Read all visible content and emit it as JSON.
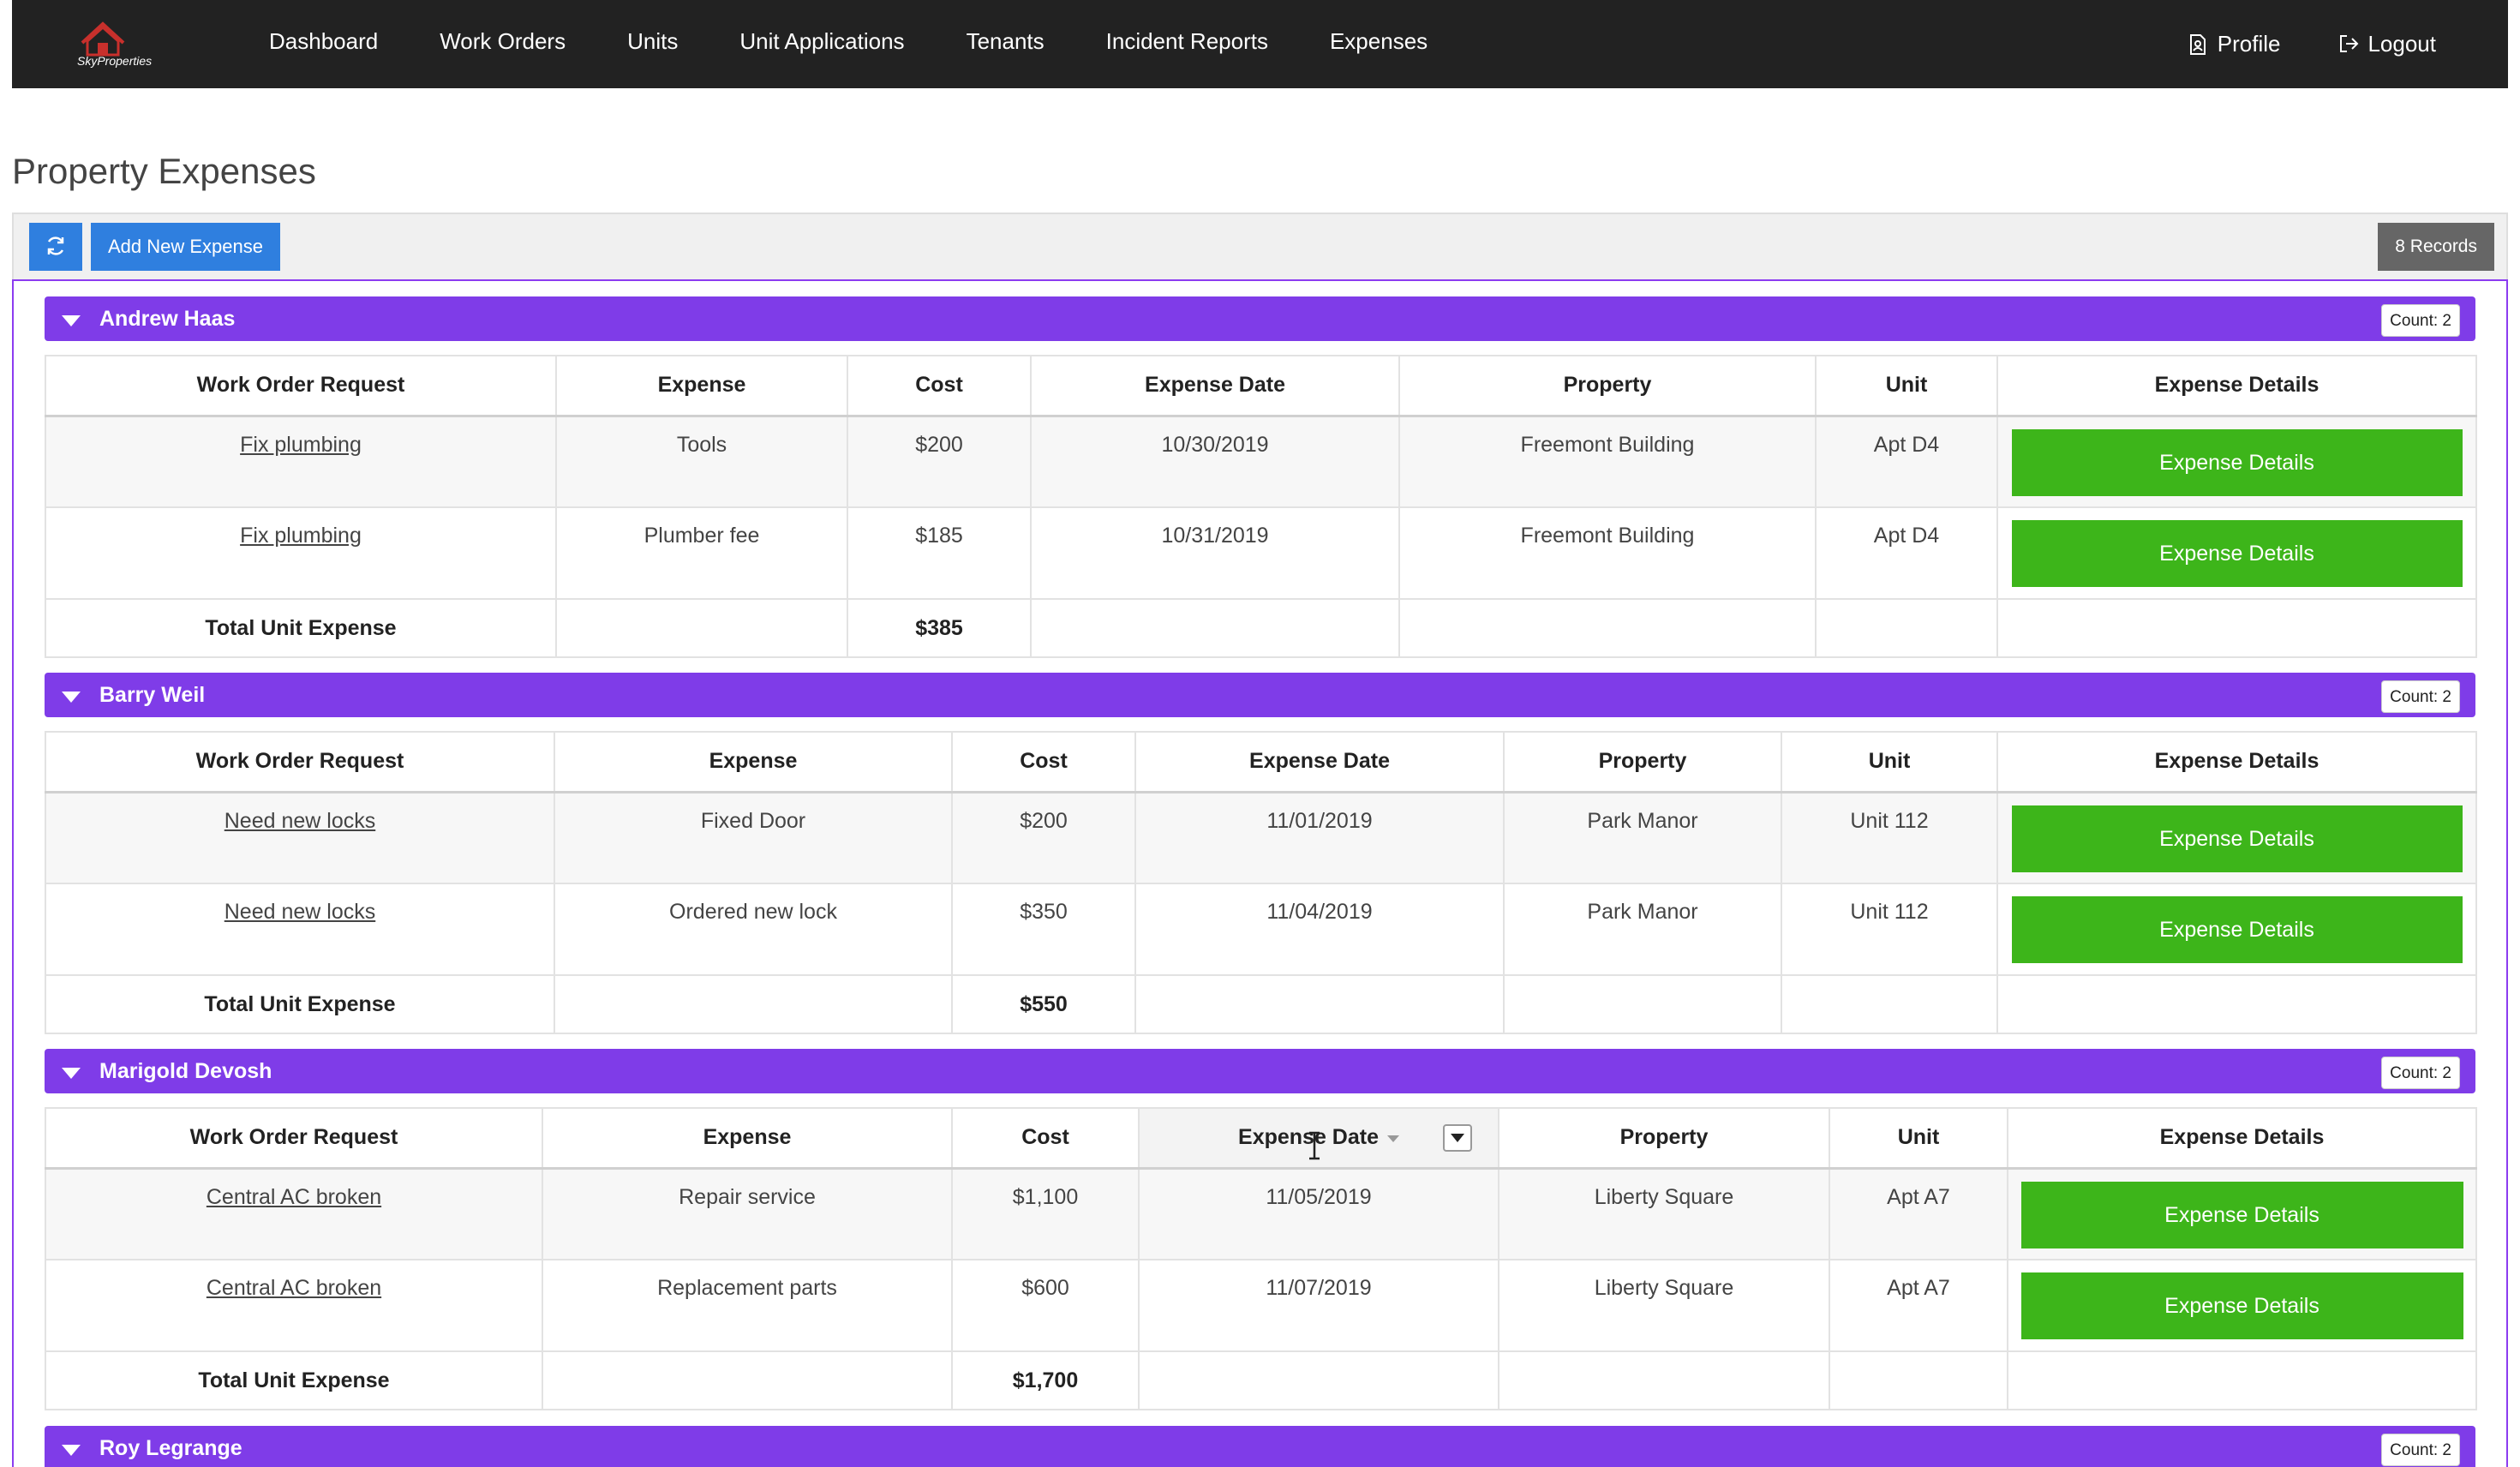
{
  "app": {
    "brand": "SkyProperties",
    "nav": [
      "Dashboard",
      "Work Orders",
      "Units",
      "Unit Applications",
      "Tenants",
      "Incident Reports",
      "Expenses"
    ],
    "profile_label": "Profile",
    "logout_label": "Logout"
  },
  "page": {
    "title": "Property Expenses",
    "add_button": "Add New Expense",
    "records": "8 Records"
  },
  "columns": [
    "Work Order Request",
    "Expense",
    "Cost",
    "Expense Date",
    "Property",
    "Unit",
    "Expense Details"
  ],
  "total_label": "Total Unit Expense",
  "details_label": "Expense Details",
  "groups": [
    {
      "name": "Andrew Haas",
      "count": "Count: 2",
      "rows": [
        {
          "work_order": "Fix plumbing",
          "expense": "Tools",
          "cost": "$200",
          "date": "10/30/2019",
          "property": "Freemont Building",
          "unit": "Apt D4"
        },
        {
          "work_order": "Fix plumbing",
          "expense": "Plumber fee",
          "cost": "$185",
          "date": "10/31/2019",
          "property": "Freemont Building",
          "unit": "Apt D4"
        }
      ],
      "total": "$385"
    },
    {
      "name": "Barry Weil",
      "count": "Count: 2",
      "rows": [
        {
          "work_order": "Need new locks",
          "expense": "Fixed Door",
          "cost": "$200",
          "date": "11/01/2019",
          "property": "Park Manor",
          "unit": "Unit 112"
        },
        {
          "work_order": "Need new locks",
          "expense": "Ordered new lock",
          "cost": "$350",
          "date": "11/04/2019",
          "property": "Park Manor",
          "unit": "Unit 112"
        }
      ],
      "total": "$550"
    },
    {
      "name": "Marigold Devosh",
      "count": "Count: 2",
      "rows": [
        {
          "work_order": "Central AC broken",
          "expense": "Repair service",
          "cost": "$1,100",
          "date": "11/05/2019",
          "property": "Liberty Square",
          "unit": "Apt A7"
        },
        {
          "work_order": "Central AC broken",
          "expense": "Replacement parts",
          "cost": "$600",
          "date": "11/07/2019",
          "property": "Liberty Square",
          "unit": "Apt A7"
        }
      ],
      "total": "$1,700"
    },
    {
      "name": "Roy Legrange",
      "count": "Count: 2",
      "rows": [],
      "total": ""
    }
  ],
  "colors": {
    "navbar": "#222222",
    "group_header": "#7f3ce8",
    "primary_button": "#2f7fdf",
    "details_button": "#3db51a",
    "records_badge": "#666666"
  },
  "icons": {
    "refresh": "refresh-icon",
    "profile": "document-icon",
    "logout": "logout-icon",
    "caret": "caret-down-icon"
  }
}
